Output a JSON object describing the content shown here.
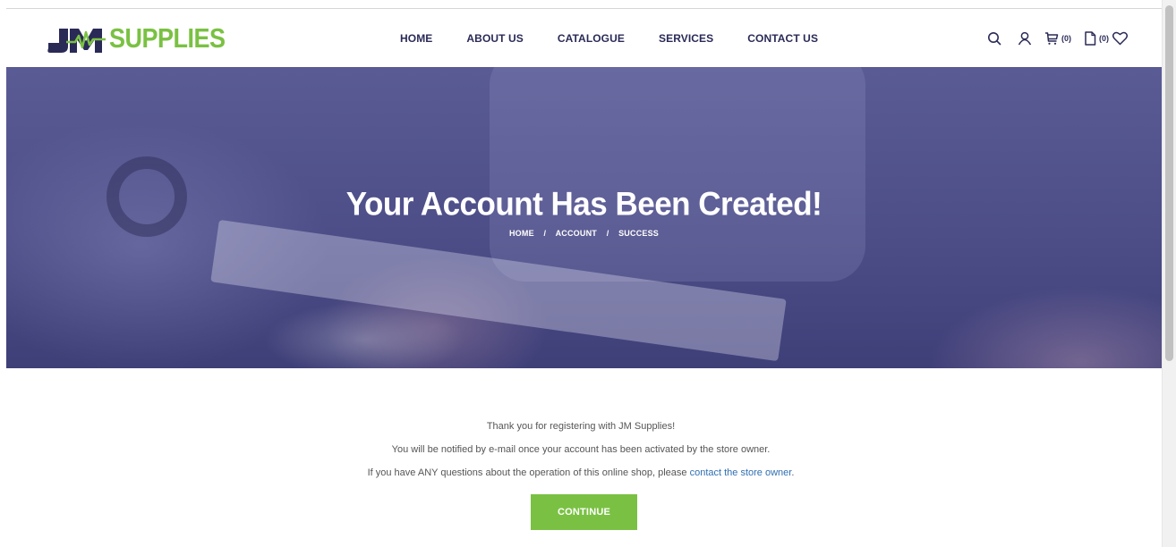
{
  "brand": {
    "logo_mark": "JM",
    "logo_word": "SUPPLIES",
    "primary_color": "#2a2a57",
    "accent_color": "#7ac143"
  },
  "nav": {
    "items": [
      "HOME",
      "ABOUT US",
      "CATALOGUE",
      "SERVICES",
      "CONTACT US"
    ]
  },
  "header_tools": {
    "search_icon": "search-icon",
    "account_icon": "user-icon",
    "cart_icon": "cart-icon",
    "cart_count": "(0)",
    "quote_icon": "document-icon",
    "quote_count": "(0)",
    "wishlist_icon": "heart-icon"
  },
  "hero": {
    "title": "Your Account Has Been Created!",
    "breadcrumb": [
      "HOME",
      "ACCOUNT",
      "SUCCESS"
    ],
    "separator": "/"
  },
  "content": {
    "line1": "Thank you for registering with JM Supplies!",
    "line2": "You will be notified by e-mail once your account has been activated by the store owner.",
    "line3_prefix": "If you have ANY questions about the operation of this online shop, please ",
    "line3_link": "contact the store owner",
    "line3_suffix": ".",
    "continue_label": "CONTINUE"
  }
}
